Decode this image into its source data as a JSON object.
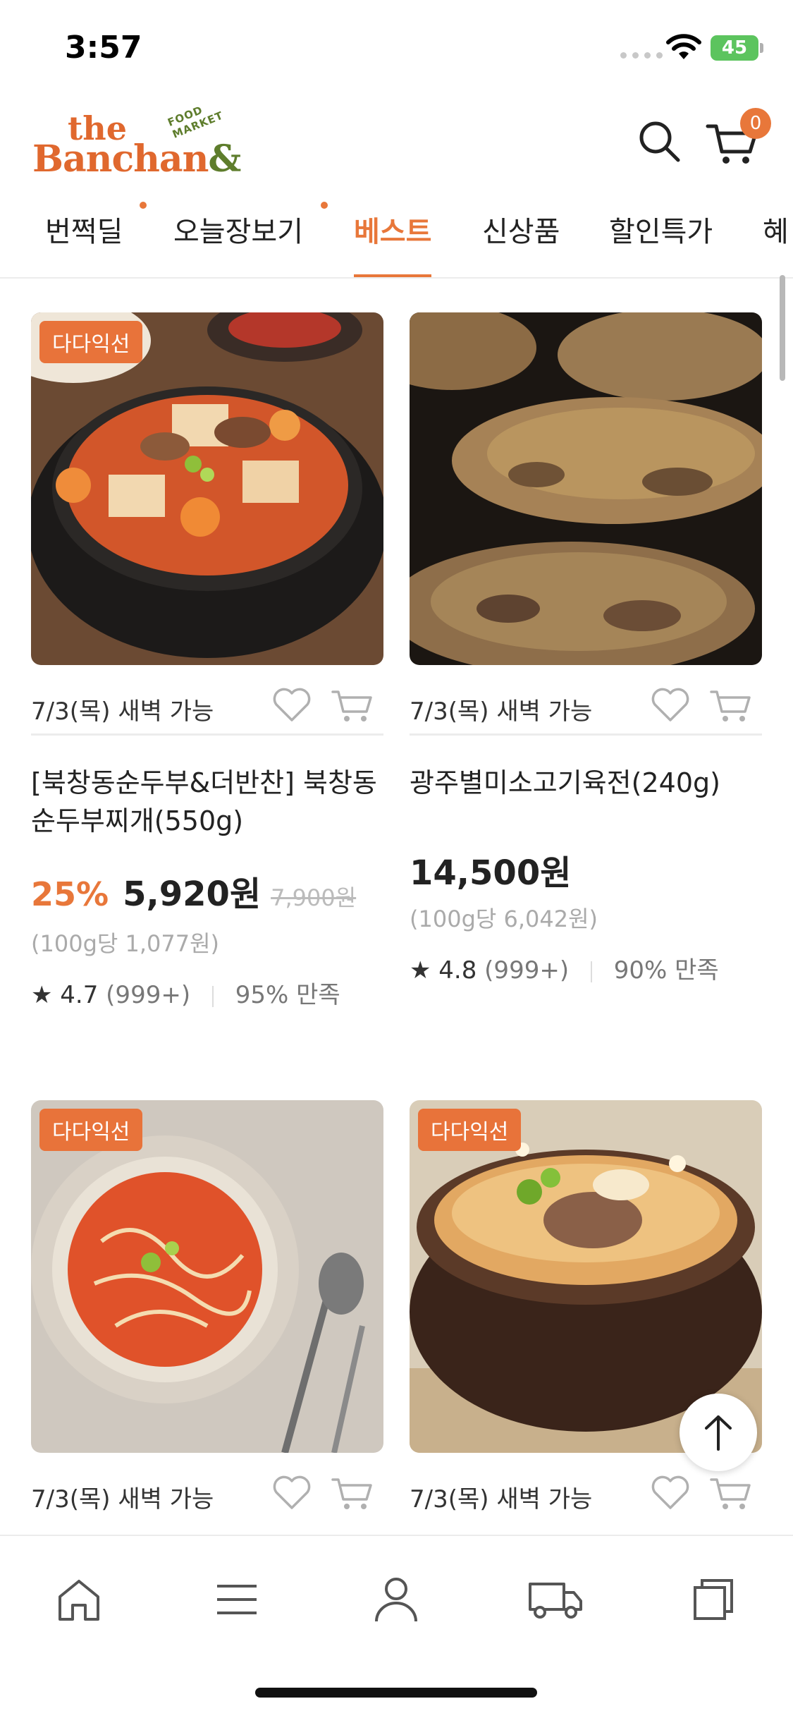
{
  "status_bar": {
    "time": "3:57",
    "battery": "45"
  },
  "header": {
    "logo_the": "the",
    "logo_banchan": "Banchan",
    "logo_amp": "&",
    "logo_tagline": "FOOD MARKET",
    "cart_count": "0"
  },
  "tabs": [
    {
      "label": "번쩍딜",
      "dot": true
    },
    {
      "label": "오늘장보기",
      "dot": true
    },
    {
      "label": "베스트",
      "active": true
    },
    {
      "label": "신상품"
    },
    {
      "label": "할인특가"
    },
    {
      "label": "혜"
    }
  ],
  "products": [
    {
      "tag": "다다익선",
      "delivery": "7/3(목) 새벽 가능",
      "title": "[북창동순두부&더반찬] 북창동순두부찌개(550g)",
      "discount": "25%",
      "price": "5,920원",
      "original_price": "7,900원",
      "unit_price": "(100g당 1,077원)",
      "rating": "★ 4.7",
      "review_count": "(999+)",
      "satisfaction": "95% 만족"
    },
    {
      "tag": "",
      "delivery": "7/3(목) 새벽 가능",
      "title": "광주별미소고기육전(240g)",
      "discount": "",
      "price": "14,500원",
      "original_price": "",
      "unit_price": "(100g당 6,042원)",
      "rating": "★ 4.8",
      "review_count": "(999+)",
      "satisfaction": "90% 만족"
    },
    {
      "tag": "다다익선",
      "delivery": "7/3(목) 새벽 가능"
    },
    {
      "tag": "다다익선",
      "delivery": "7/3(목) 새벽 가능"
    }
  ],
  "bottom_nav": [
    {
      "icon": "home-icon"
    },
    {
      "icon": "menu-icon"
    },
    {
      "icon": "user-icon"
    },
    {
      "icon": "truck-icon"
    },
    {
      "icon": "recent-icon"
    }
  ],
  "colors": {
    "accent": "#e8773a",
    "brand_green": "#5e7d2c"
  }
}
